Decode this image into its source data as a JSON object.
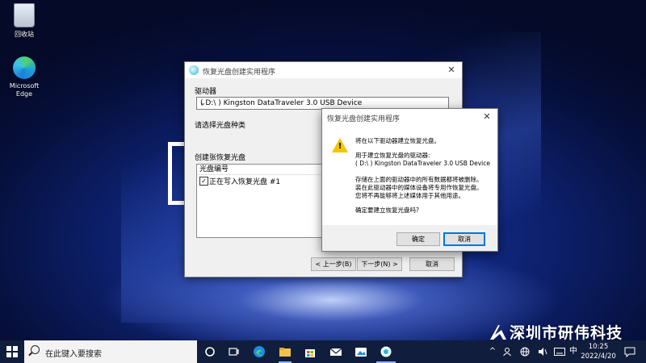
{
  "desktop": {
    "icons": [
      {
        "label": "回收站"
      },
      {
        "label": "Microsoft Edge"
      }
    ],
    "watermark": "深圳市研伟科技"
  },
  "wizard": {
    "title": "恢复光盘创建实用程序",
    "drive_label": "驱动器",
    "drive_value": "( D:\\ ) Kingston DataTraveler 3.0 USB Device",
    "disc_type_label": "请选择光盘种类",
    "create_label": "创建张恢复光盘",
    "list_header": "光盘编号",
    "list_items": [
      {
        "label": "正在写入恢复光盘 #1",
        "checked": true
      }
    ],
    "buttons": {
      "back": "< 上一步(B)",
      "next": "下一步(N) >",
      "cancel": "取消"
    }
  },
  "dialog": {
    "title": "恢复光盘创建实用程序",
    "icon": "warning-icon",
    "line1": "将在以下驱动器建立恢复光盘。",
    "line2": "用于建立恢复光盘的驱动器:",
    "line3": "( D:\\ ) Kingston DataTraveler 3.0 USB Device",
    "line4": "存储在上面的驱动器中的所有数据都将被删除。",
    "line5": "装在此驱动器中的媒体设备将专用作恢复光盘。",
    "line6": "您将不再能够将上述媒体用于其他用途。",
    "line7": "确定要建立恢复光盘吗?",
    "ok": "确定",
    "cancel": "取消"
  },
  "taskbar": {
    "search_placeholder": "在此键入要搜索",
    "apps": [
      "cortana-icon",
      "task-view-icon",
      "edge-icon",
      "file-explorer-icon",
      "store-icon",
      "mail-icon",
      "photos-icon",
      "recovery-app-icon"
    ],
    "tray": {
      "chevron": "^",
      "ime": "中"
    },
    "time": "10:25",
    "date": "2022/4/20"
  }
}
